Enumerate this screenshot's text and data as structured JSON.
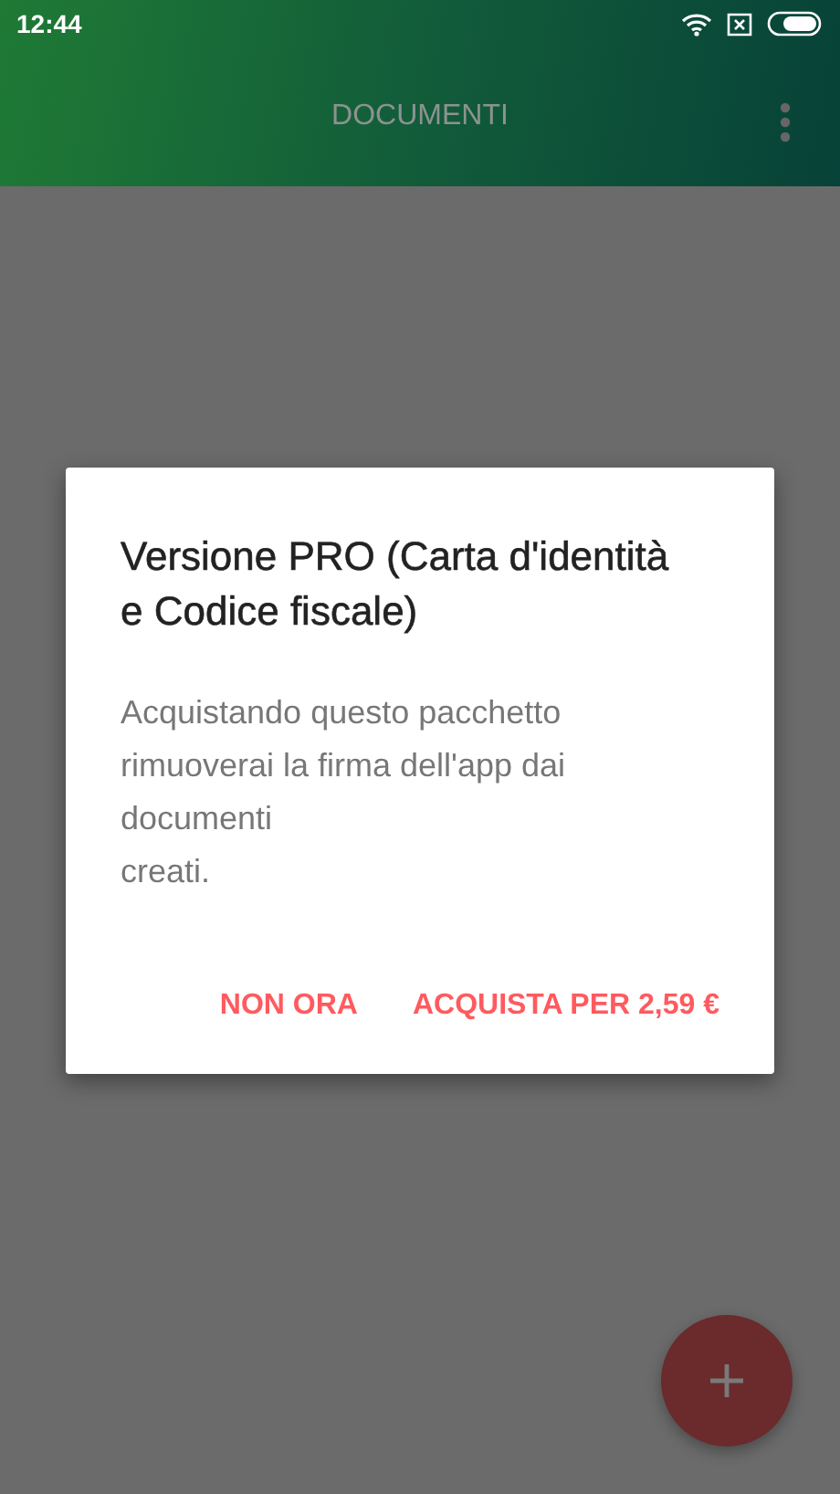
{
  "status_bar": {
    "time": "12:44"
  },
  "app_bar": {
    "title": "DOCUMENTI"
  },
  "dialog": {
    "title": "Versione PRO (Carta d'identità e Codice fiscale)",
    "body": "Acquistando questo pacchetto rimuoverai la firma dell'app dai documenti\ncreati.",
    "buttons": [
      {
        "label": "NON ORA"
      },
      {
        "label": "ACQUISTA PER 2,59 €"
      }
    ]
  }
}
